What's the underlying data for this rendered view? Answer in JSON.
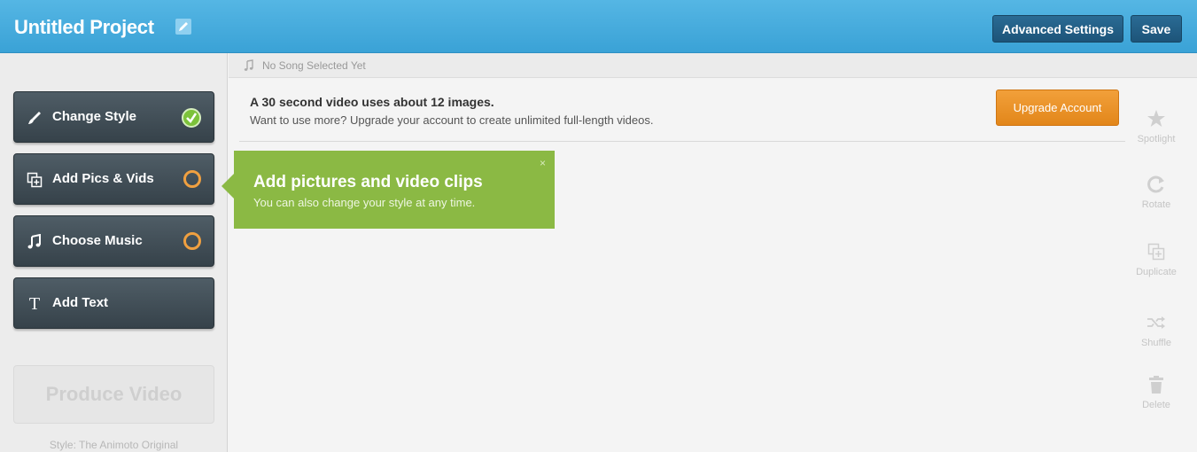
{
  "header": {
    "project_title": "Untitled Project",
    "advanced_settings_label": "Advanced Settings",
    "save_label": "Save"
  },
  "sidebar": {
    "steps": [
      {
        "label": "Change Style",
        "icon": "brush-icon",
        "status": "complete"
      },
      {
        "label": "Add Pics & Vids",
        "icon": "add-media-icon",
        "status": "pending"
      },
      {
        "label": "Choose Music",
        "icon": "music-note-icon",
        "status": "pending"
      },
      {
        "label": "Add Text",
        "icon": "text-icon",
        "status": "none"
      }
    ],
    "produce_label": "Produce Video",
    "style_note": "Style: The Animoto Original"
  },
  "song_bar": {
    "text": "No Song Selected Yet"
  },
  "notice": {
    "title": "A 30 second video uses about 12 images.",
    "body": "Want to use more? Upgrade your account to create unlimited full-length videos.",
    "upgrade_label": "Upgrade Account"
  },
  "tooltip": {
    "title": "Add pictures and video clips",
    "subtitle": "You can also change your style at any time.",
    "close": "×"
  },
  "toolbar": {
    "items": [
      {
        "label": "Spotlight",
        "icon": "star-icon"
      },
      {
        "label": "Rotate",
        "icon": "rotate-icon"
      },
      {
        "label": "Duplicate",
        "icon": "duplicate-icon"
      },
      {
        "label": "Shuffle",
        "icon": "shuffle-icon"
      },
      {
        "label": "Delete",
        "icon": "trash-icon"
      }
    ]
  },
  "colors": {
    "header": "#3aa2d6",
    "step_bg": "#404c54",
    "complete": "#7cc23a",
    "pending": "#f0a040",
    "tooltip": "#8bb944",
    "upgrade": "#e8902a"
  }
}
